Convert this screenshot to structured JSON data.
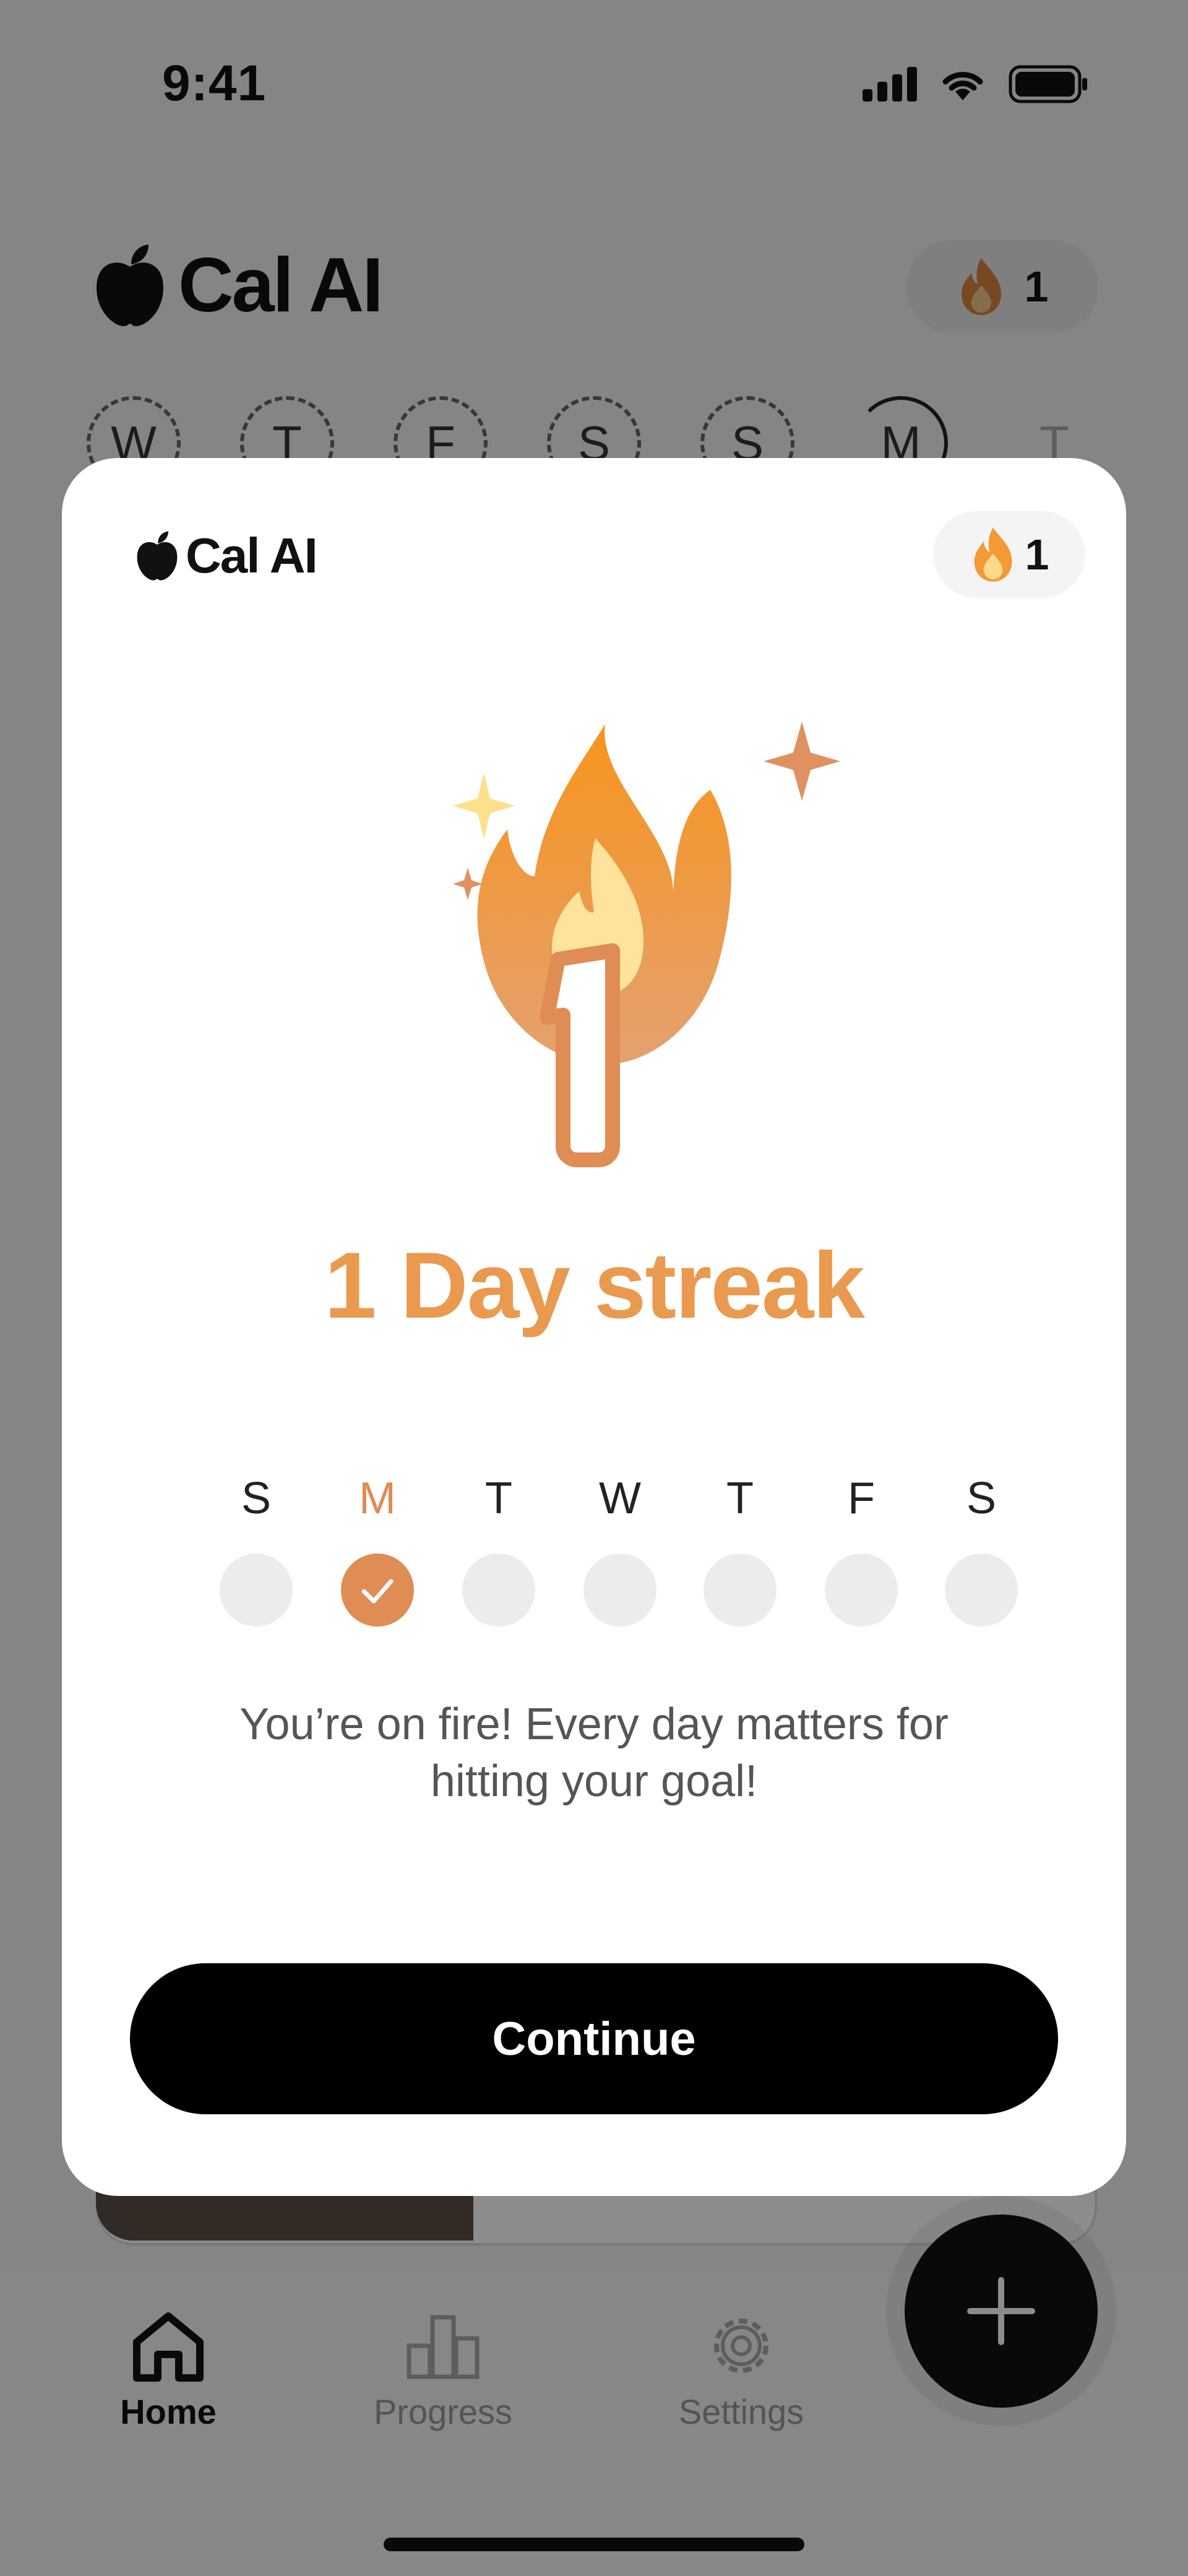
{
  "status_bar": {
    "time": "9:41"
  },
  "app_header": {
    "logo_text": "Cal AI",
    "streak_count": "1"
  },
  "week_strip": {
    "days": [
      "W",
      "T",
      "F",
      "S",
      "S",
      "M",
      "T"
    ]
  },
  "bottom_nav": {
    "items": [
      {
        "label": "Home",
        "active": true
      },
      {
        "label": "Progress",
        "active": false
      },
      {
        "label": "Settings",
        "active": false
      }
    ]
  },
  "modal": {
    "logo_text": "Cal AI",
    "streak_count": "1",
    "hero_number": "1",
    "title": "1 Day streak",
    "days": [
      {
        "letter": "S",
        "checked": false
      },
      {
        "letter": "M",
        "checked": true
      },
      {
        "letter": "T",
        "checked": false
      },
      {
        "letter": "W",
        "checked": false
      },
      {
        "letter": "T",
        "checked": false
      },
      {
        "letter": "F",
        "checked": false
      },
      {
        "letter": "S",
        "checked": false
      }
    ],
    "message_line1": "You’re on fire! Every day matters for",
    "message_line2": "hitting your goal!",
    "continue_label": "Continue"
  },
  "colors": {
    "accent": "#e99a4f",
    "checked": "#df8d55",
    "button": "#000000"
  }
}
